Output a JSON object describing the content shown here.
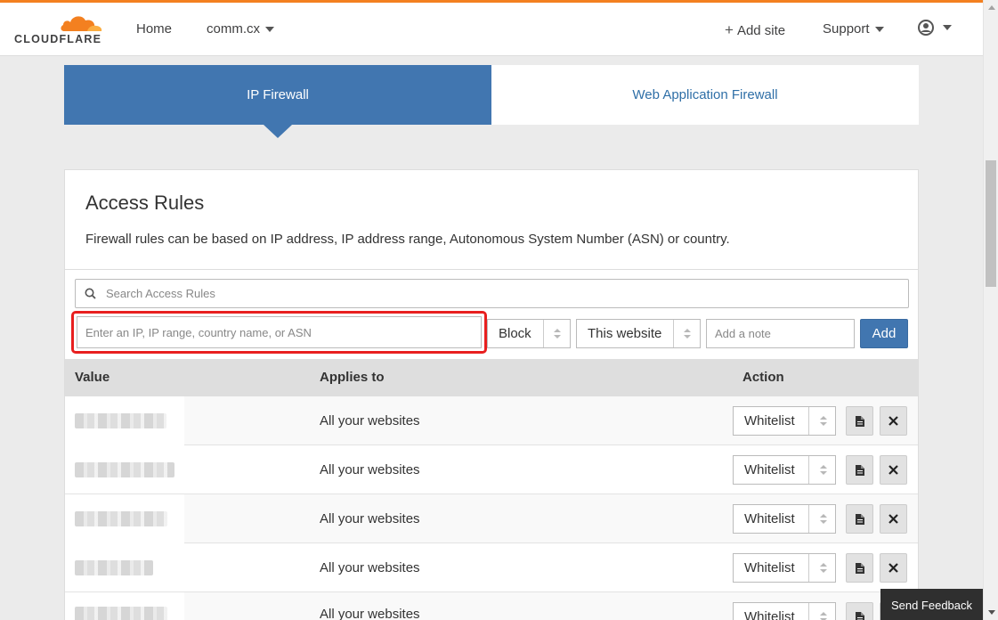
{
  "brand": {
    "name": "CLOUDFLARE",
    "accent": "#f38020",
    "primary": "#4176b0"
  },
  "nav": {
    "home": "Home",
    "domain": "comm.cx",
    "add_site": "Add site",
    "support": "Support"
  },
  "tabs": [
    {
      "label": "IP Firewall",
      "active": true
    },
    {
      "label": "Web Application Firewall",
      "active": false
    }
  ],
  "access_rules": {
    "title": "Access Rules",
    "description": "Firewall rules can be based on IP address, IP address range, Autonomous System Number (ASN) or country.",
    "search_placeholder": "Search Access Rules",
    "ip_placeholder": "Enter an IP, IP range, country name, or ASN",
    "mode_select": "Block",
    "scope_select": "This website",
    "note_placeholder": "Add a note",
    "add_button": "Add"
  },
  "table": {
    "headers": {
      "value": "Value",
      "applies_to": "Applies to",
      "action": "Action"
    },
    "rows": [
      {
        "applies_to": "All your websites",
        "action": "Whitelist"
      },
      {
        "applies_to": "All your websites",
        "action": "Whitelist"
      },
      {
        "applies_to": "All your websites",
        "action": "Whitelist"
      },
      {
        "applies_to": "All your websites",
        "action": "Whitelist"
      },
      {
        "applies_to": "All your websites",
        "action": "Whitelist"
      }
    ]
  },
  "feedback": {
    "label": "Send Feedback"
  },
  "icons": [
    "cloudflare-logo",
    "plus-icon",
    "user-icon",
    "search-icon",
    "note-icon",
    "close-icon"
  ]
}
